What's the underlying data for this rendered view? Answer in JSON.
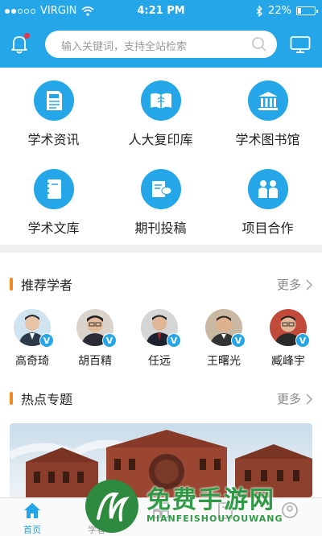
{
  "status_bar": {
    "carrier": "VIRGIN",
    "time": "4:21 PM",
    "battery": "22%",
    "battery_level": 0.22
  },
  "header": {
    "search_placeholder": "输入关键词，支持全站检索"
  },
  "grid": [
    {
      "label": "学术资讯",
      "icon": "news-icon"
    },
    {
      "label": "人大复印库",
      "icon": "book-open-icon"
    },
    {
      "label": "学术图书馆",
      "icon": "library-icon"
    },
    {
      "label": "学术文库",
      "icon": "notebook-icon"
    },
    {
      "label": "期刊投稿",
      "icon": "document-chat-icon"
    },
    {
      "label": "项目合作",
      "icon": "people-icon"
    }
  ],
  "recommended": {
    "title": "推荐学者",
    "more": "更多",
    "scholars": [
      {
        "name": "高奇琦",
        "badge": "V"
      },
      {
        "name": "胡百精",
        "badge": "V"
      },
      {
        "name": "任远",
        "badge": "V"
      },
      {
        "name": "王曙光",
        "badge": "V"
      },
      {
        "name": "臧峰宇",
        "badge": "V"
      }
    ]
  },
  "hot_topics": {
    "title": "热点专题",
    "more": "更多"
  },
  "tabbar": [
    {
      "label": "首页",
      "active": true
    },
    {
      "label": "学者",
      "active": false
    },
    {
      "label": "",
      "active": false
    },
    {
      "label": "",
      "active": false
    },
    {
      "label": "",
      "active": false
    }
  ],
  "watermark": {
    "title": "免费手游网",
    "subtitle": "MIANFEISHOUYOUWANG"
  },
  "colors": {
    "primary": "#24a6e8",
    "accent": "#f08a24",
    "badge_dot": "#e8334a"
  }
}
